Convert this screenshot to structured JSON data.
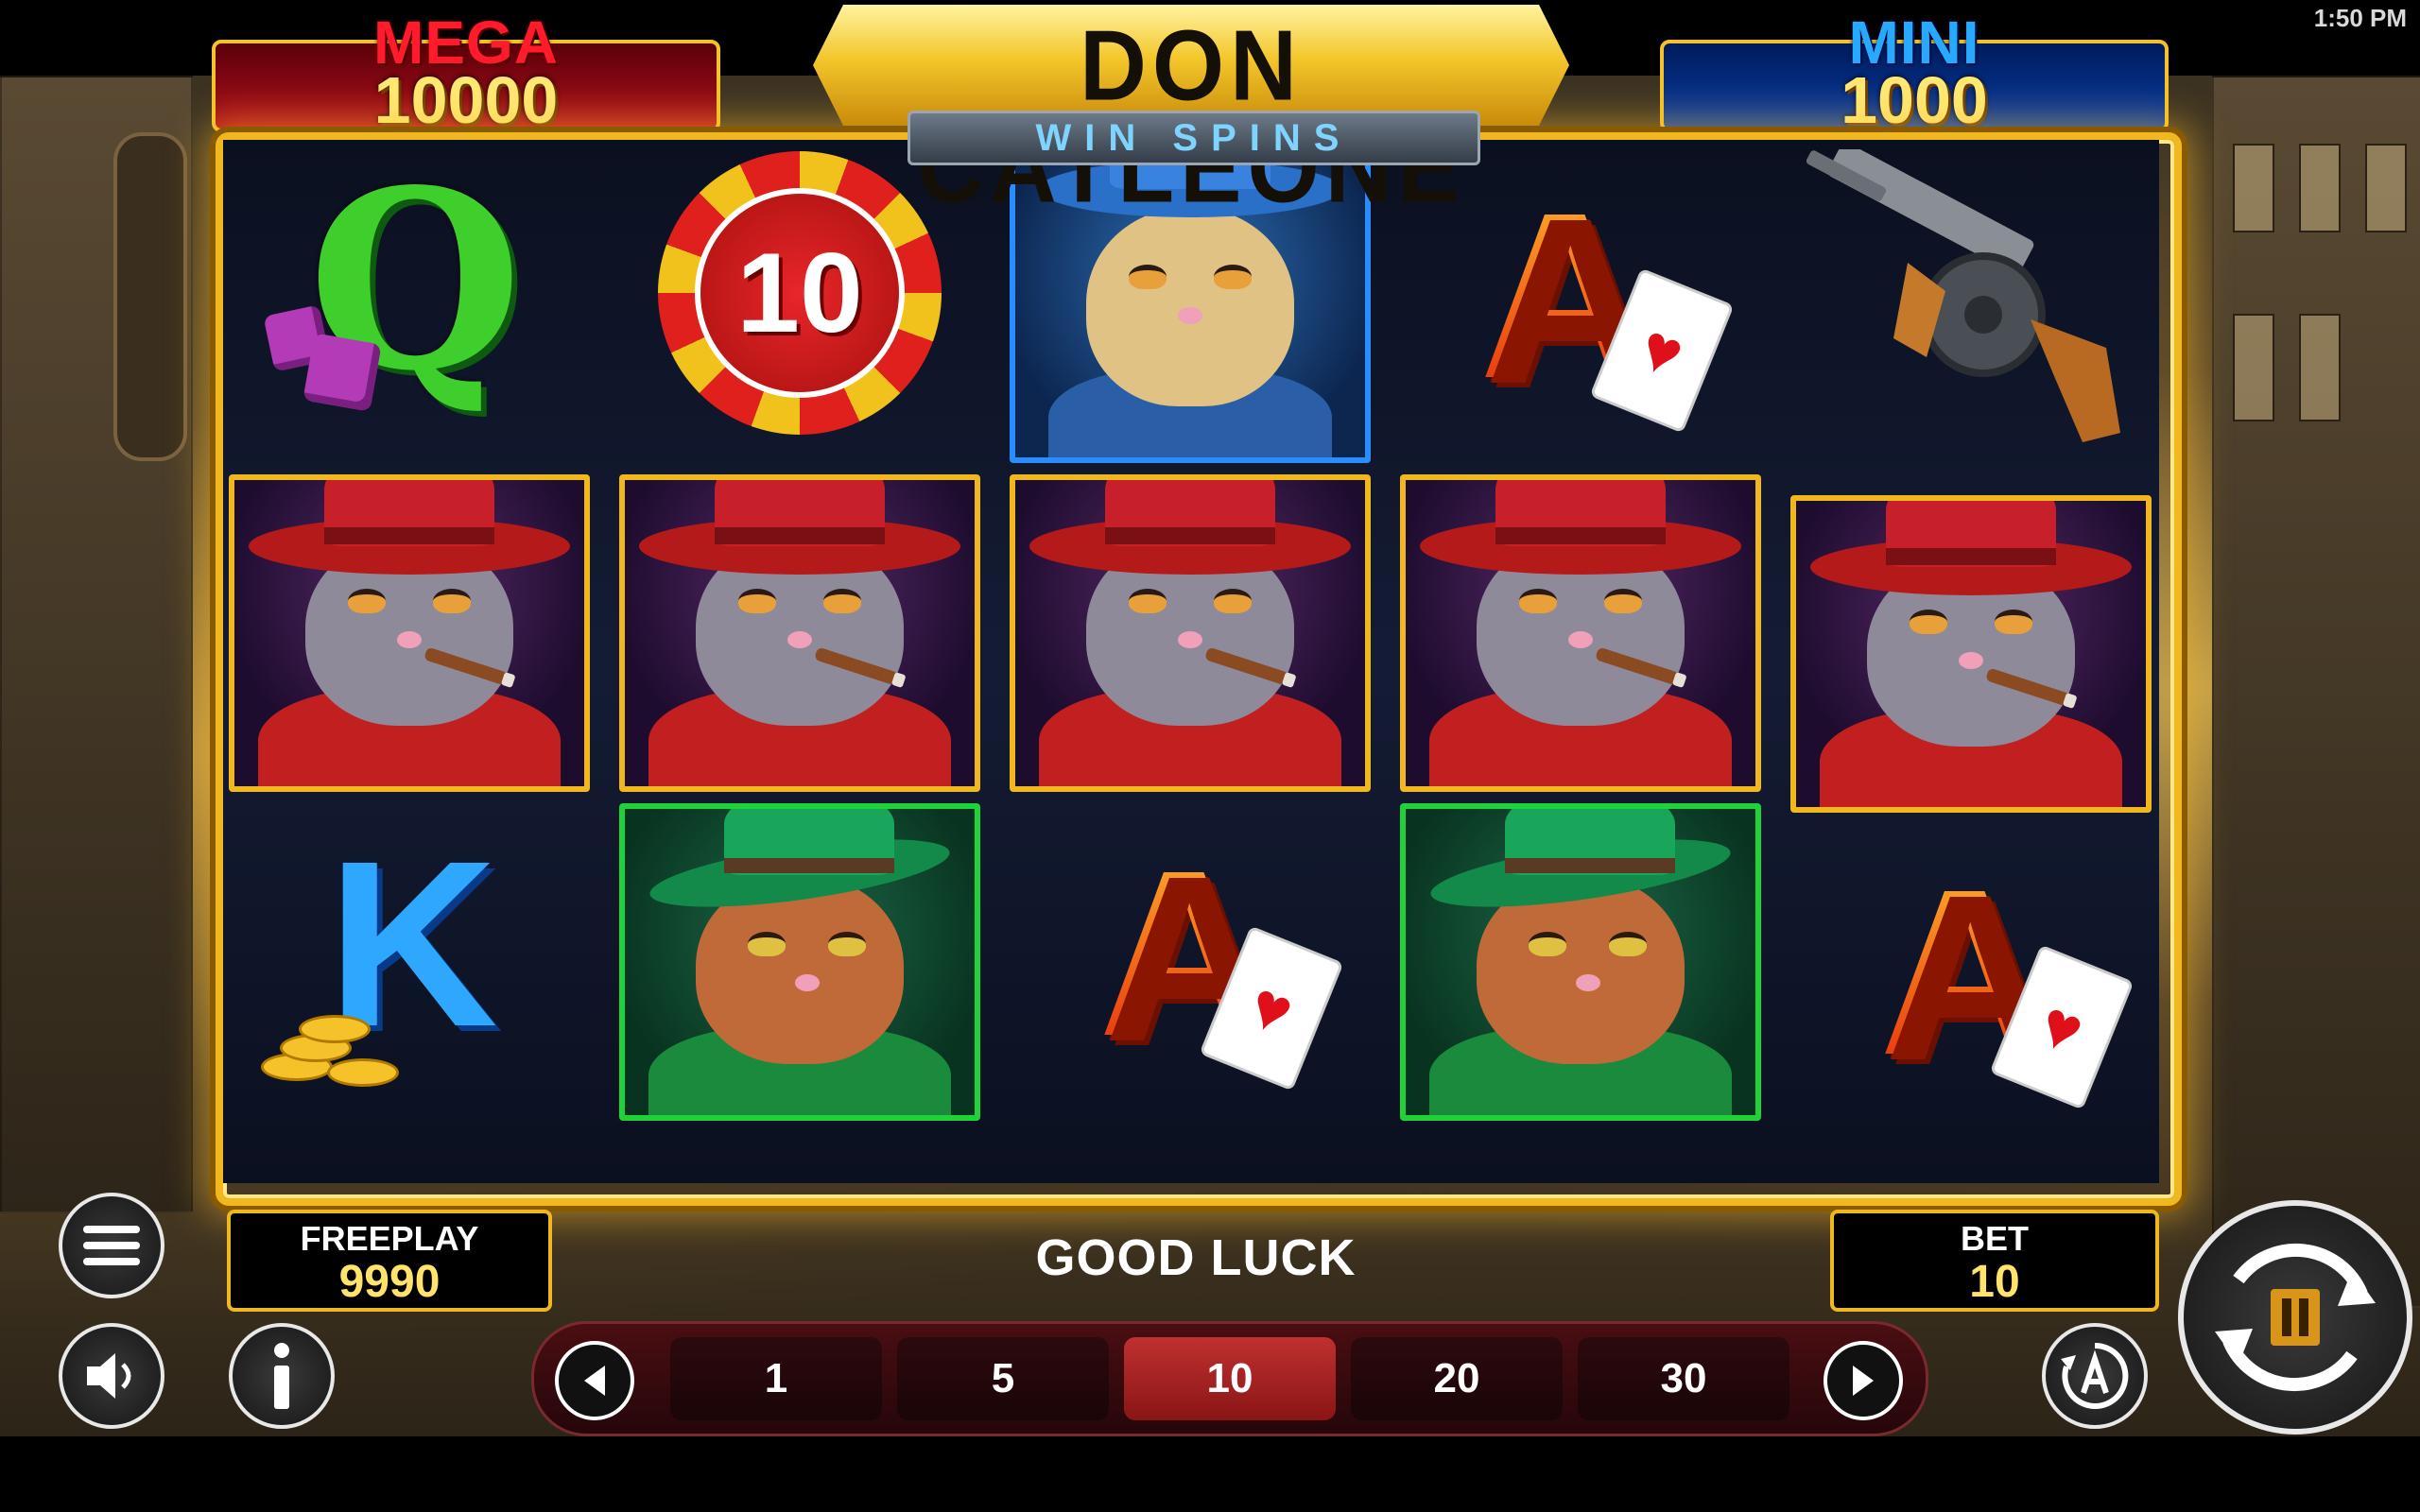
{
  "status_bar": {
    "time": "1:50 PM"
  },
  "game": {
    "title": "DON CATLEONE",
    "subtitle": "WIN SPINS"
  },
  "jackpots": {
    "mega": {
      "label": "MEGA",
      "value": "10000"
    },
    "mini": {
      "label": "MINI",
      "value": "1000"
    }
  },
  "reels": [
    [
      "dice-queen",
      "mafia-boss-cat",
      "king-coins"
    ],
    [
      "chip-10",
      "mafia-boss-cat",
      "green-hat-cat"
    ],
    [
      "blue-hat-cat",
      "mafia-boss-cat",
      "ace-hearts"
    ],
    [
      "ace-hearts",
      "mafia-boss-cat",
      "green-hat-cat"
    ],
    [
      "tommy-gun",
      "mafia-boss-cat",
      "ace-hearts"
    ]
  ],
  "symbols": {
    "queen": "Q",
    "king": "K",
    "ace": "A",
    "heart": "♥",
    "chip": "10"
  },
  "freeplay": {
    "label": "FREEPLAY",
    "value": "9990"
  },
  "message": "GOOD LUCK",
  "bet": {
    "label": "BET",
    "value": "10"
  },
  "bet_options": [
    "1",
    "5",
    "10",
    "20",
    "30"
  ],
  "selected_bet": "10",
  "icons": {
    "menu": "hamburger-menu-icon",
    "sound": "speaker-icon",
    "info": "info-icon",
    "prev": "chevron-left-icon",
    "next": "chevron-right-icon",
    "auto": "autoplay-icon",
    "spin": "spin-pause-icon"
  },
  "colors": {
    "frame_gold": "#f0b81e",
    "mega_red": "#ff1b2b",
    "mini_blue": "#27a9ff",
    "jackpot_value": "#ffe873",
    "bet_selected": "#c03030"
  }
}
